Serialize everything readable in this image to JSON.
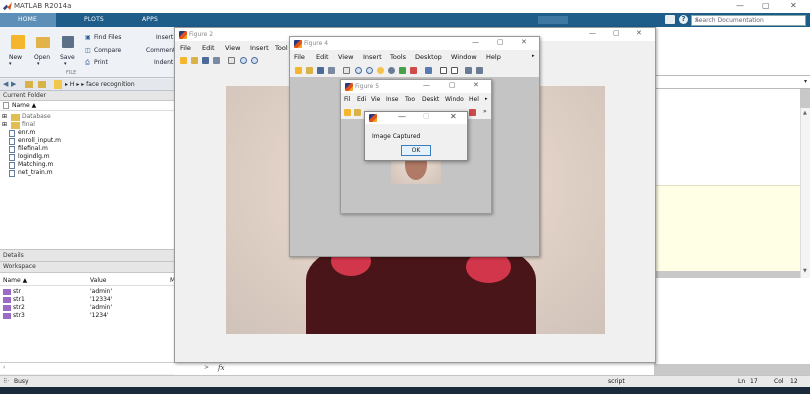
{
  "app": {
    "title": "MATLAB R2014a",
    "minimize": "—",
    "restore": "▢",
    "close": "✕"
  },
  "tabs": [
    "HOME",
    "PLOTS",
    "APPS"
  ],
  "search": {
    "placeholder": "Search Documentation"
  },
  "ribbon": {
    "new": "New",
    "open": "Open",
    "save": "Save",
    "find_files": "Find Files",
    "compare": "Compare",
    "print": "Print",
    "insert": "Insert",
    "comment": "Comment",
    "indent": "Indent",
    "group_file": "FILE"
  },
  "address": {
    "path": "▸ H ▸ ▸ face recognition"
  },
  "current_folder": {
    "header": "Current Folder",
    "column": "Name ▲",
    "items": [
      {
        "name": "Database",
        "kind": "folder"
      },
      {
        "name": "final",
        "kind": "folder"
      },
      {
        "name": "enr.m",
        "kind": "file"
      },
      {
        "name": "enroll_input.m",
        "kind": "file"
      },
      {
        "name": "filefinal.m",
        "kind": "file"
      },
      {
        "name": "logindlg.m",
        "kind": "file"
      },
      {
        "name": "Matching.m",
        "kind": "file"
      },
      {
        "name": "net_train.m",
        "kind": "file"
      }
    ]
  },
  "details": {
    "header": "Details"
  },
  "workspace": {
    "header": "Workspace",
    "columns": [
      "Name ▲",
      "Value",
      "M"
    ],
    "rows": [
      {
        "name": "str",
        "value": "'admin'"
      },
      {
        "name": "str1",
        "value": "'12334'"
      },
      {
        "name": "str2",
        "value": "'admin'"
      },
      {
        "name": "str3",
        "value": "'1234'"
      }
    ]
  },
  "command": {
    "fx": "fx",
    "prompt": ">"
  },
  "status": {
    "busy": "Busy",
    "mode": "script",
    "ln_label": "Ln",
    "ln": "17",
    "col_label": "Col",
    "col": "12"
  },
  "figures": {
    "fig2": {
      "title": "Figure 2",
      "menu": [
        "File",
        "Edit",
        "View",
        "Insert",
        "Tool"
      ]
    },
    "fig4": {
      "title": "Figure 4",
      "menu": [
        "File",
        "Edit",
        "View",
        "Insert",
        "Tools",
        "Desktop",
        "Window",
        "Help"
      ]
    },
    "fig5": {
      "title": "Figure 5",
      "menu": [
        "Fil",
        "Edi",
        "Vie",
        "Inse",
        "Too",
        "Deskt",
        "Windo",
        "Hel"
      ]
    }
  },
  "dialog": {
    "message": "Image Captured",
    "ok": "OK"
  }
}
